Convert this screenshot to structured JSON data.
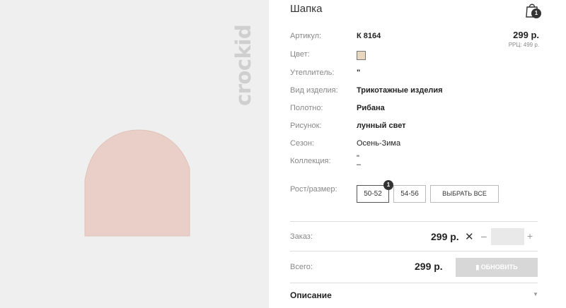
{
  "gallery": {
    "brand": "crockid"
  },
  "product": {
    "title": "Шапка",
    "price": "299 р.",
    "rrp": "РРЦ: 499 р.",
    "swatch_color": "#e6d7bd"
  },
  "cart": {
    "count": "1"
  },
  "attributes": [
    {
      "label": "Артикул:",
      "value": "К 8164"
    },
    {
      "label": "Цвет:",
      "value": ""
    },
    {
      "label": "Утеплитель:",
      "value": "\""
    },
    {
      "label": "Вид изделия:",
      "value": "Трикотажные изделия"
    },
    {
      "label": "Полотно:",
      "value": "Рибана"
    },
    {
      "label": "Рисунок:",
      "value": "лунный свет"
    },
    {
      "label": "Сезон:",
      "value": "Осень-Зима"
    },
    {
      "label": "Коллекция:",
      "value": "\"\n–"
    }
  ],
  "sizes": {
    "label": "Рост/размер:",
    "options": [
      "50-52",
      "54-56"
    ],
    "selected": "50-52",
    "selected_count": "1",
    "select_all": "ВЫБРАТЬ ВСЕ"
  },
  "order": {
    "label": "Заказ:",
    "price": "299 р.",
    "remove_icon": "x-icon",
    "minus": "–",
    "plus": "+"
  },
  "total": {
    "label": "Всего:",
    "price": "299 р.",
    "refresh": "ОБНОВИТЬ"
  },
  "description": {
    "label": "Описание",
    "caret": "▼"
  }
}
